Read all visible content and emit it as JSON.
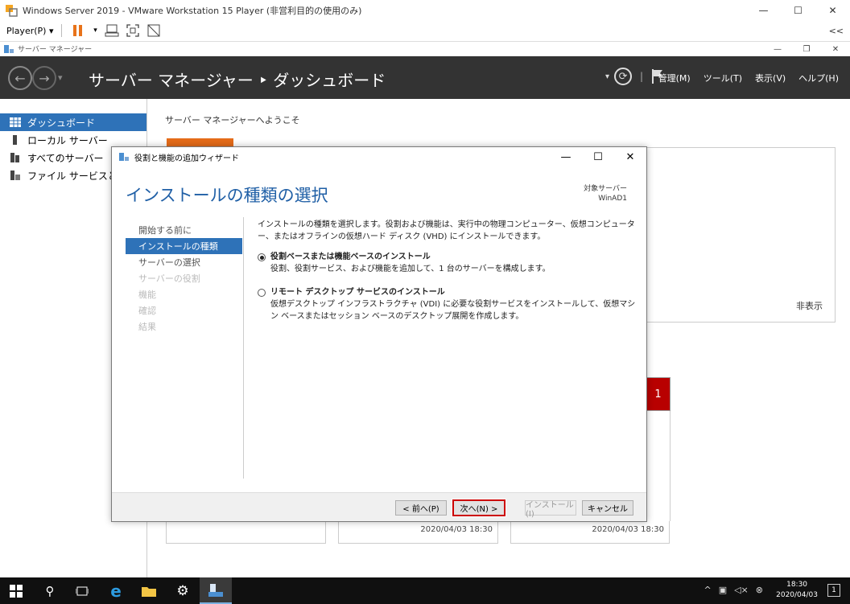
{
  "vmware": {
    "title": "Windows Server 2019 - VMware Workstation 15 Player (非営利目的の使用のみ)",
    "player_menu": "Player(P)",
    "collapse": "<<"
  },
  "server_manager": {
    "window_title": "サーバー マネージャー",
    "breadcrumb": "サーバー マネージャー ‣ ダッシュボード",
    "menu": [
      "管理(M)",
      "ツール(T)",
      "表示(V)",
      "ヘルプ(H)"
    ],
    "nav": [
      {
        "label": "ダッシュボード",
        "active": true
      },
      {
        "label": "ローカル サーバー"
      },
      {
        "label": "すべてのサーバー"
      },
      {
        "label": "ファイル サービスと記憶"
      }
    ],
    "welcome": "サーバー マネージャーへようこそ",
    "hide_label": "非表示",
    "badge_count": "1",
    "timestamps": [
      "2020/04/03 18:30",
      "2020/04/03 18:30"
    ]
  },
  "wizard": {
    "title": "役割と機能の追加ウィザード",
    "heading": "インストールの種類の選択",
    "target_label": "対象サーバー",
    "target_server": "WinAD1",
    "steps": [
      {
        "label": "開始する前に",
        "state": "normal"
      },
      {
        "label": "インストールの種類",
        "state": "active"
      },
      {
        "label": "サーバーの選択",
        "state": "normal"
      },
      {
        "label": "サーバーの役割",
        "state": "disabled"
      },
      {
        "label": "機能",
        "state": "disabled"
      },
      {
        "label": "確認",
        "state": "disabled"
      },
      {
        "label": "結果",
        "state": "disabled"
      }
    ],
    "description": "インストールの種類を選択します。役割および機能は、実行中の物理コンピューター、仮想コンピューター、またはオフラインの仮想ハード ディスク (VHD) にインストールできます。",
    "options": [
      {
        "title": "役割ベースまたは機能ベースのインストール",
        "desc": "役割、役割サービス、および機能を追加して、1 台のサーバーを構成します。",
        "selected": true
      },
      {
        "title": "リモート デスクトップ サービスのインストール",
        "desc": "仮想デスクトップ インフラストラクチャ (VDI) に必要な役割サービスをインストールして、仮想マシン ベースまたはセッション ベースのデスクトップ展開を作成します。",
        "selected": false
      }
    ],
    "buttons": {
      "prev": "< 前へ(P)",
      "next": "次へ(N) >",
      "install": "インストール(I)",
      "cancel": "キャンセル"
    }
  },
  "taskbar": {
    "time": "18:30",
    "date": "2020/04/03"
  },
  "colors": {
    "accent": "#2e72b8",
    "header": "#333333",
    "badge": "#b80000",
    "highlight": "#cc0000"
  }
}
